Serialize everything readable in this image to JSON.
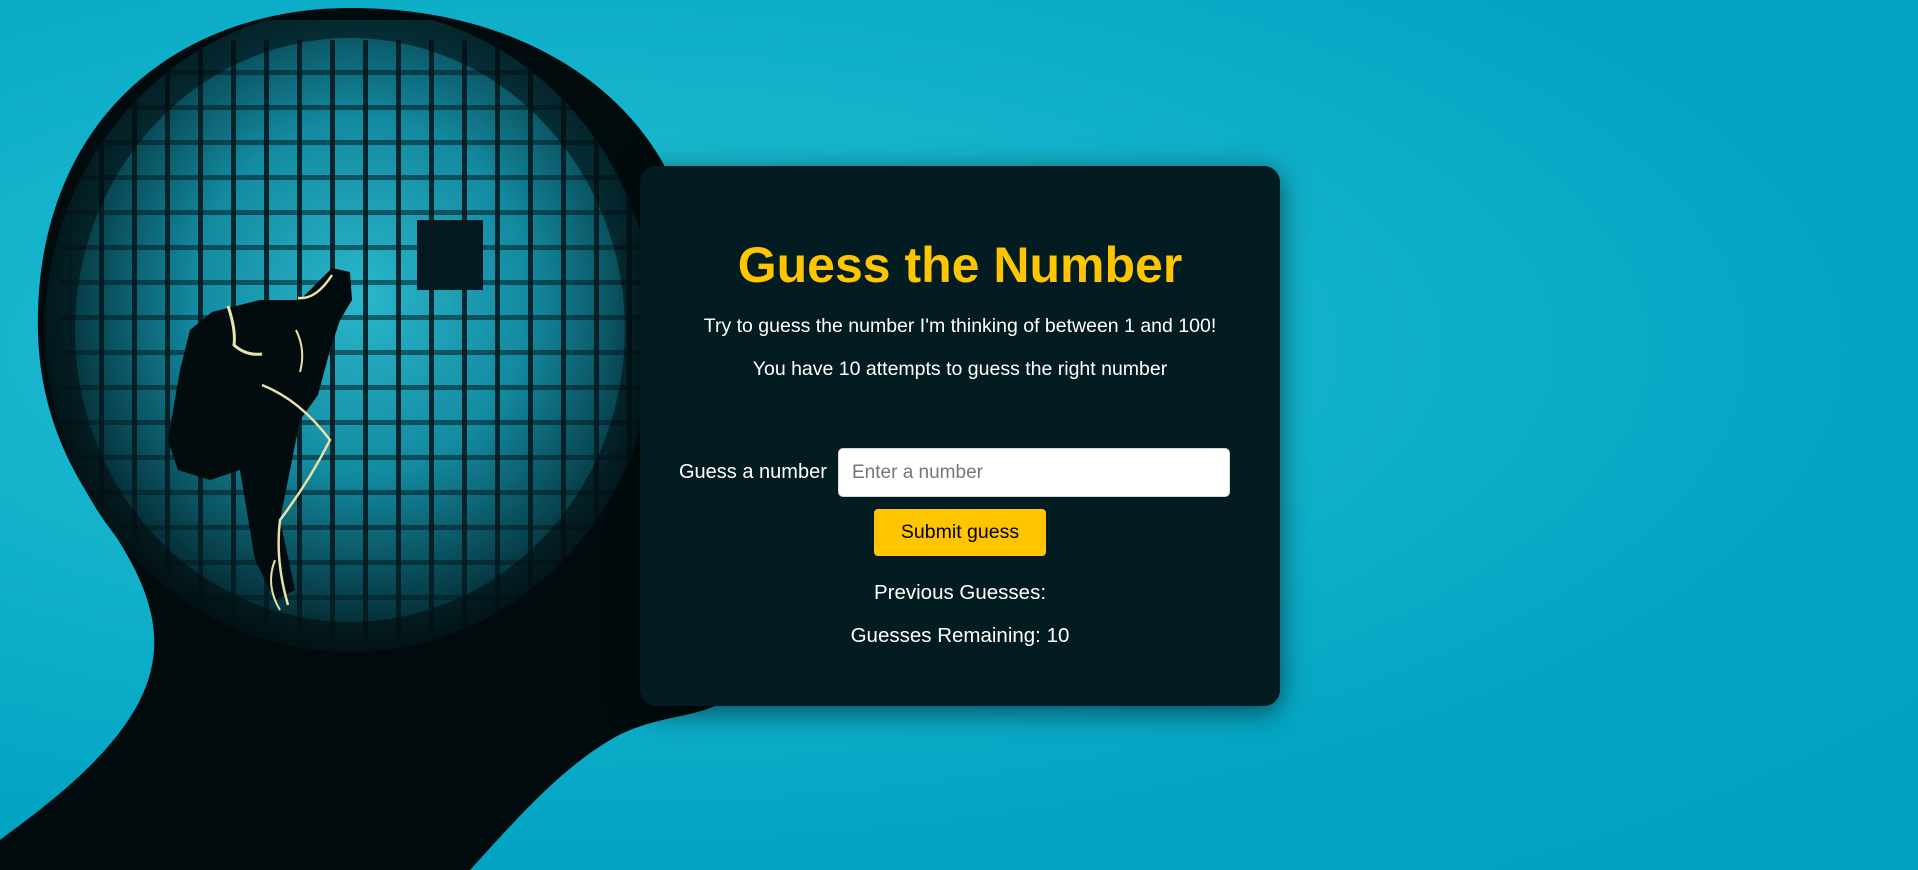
{
  "game": {
    "title": "Guess the Number",
    "intro_line": "Try to guess the number I'm thinking of between 1 and 100!",
    "attempts_line": "You have 10 attempts to guess the right number"
  },
  "form": {
    "label": "Guess a number",
    "input_value": "",
    "input_placeholder": "Enter a number",
    "submit_label": "Submit guess"
  },
  "status": {
    "previous_guesses_label": "Previous Guesses:",
    "guesses_remaining_label": "Guesses Remaining:",
    "guesses_remaining_value": "10",
    "guesses_remaining_text": "Guesses Remaining: 10"
  },
  "colors": {
    "background": "#00a1c0",
    "card": "#021c21",
    "accent": "#ffc600",
    "text": "#ffffff"
  },
  "background_art": {
    "icon": "head-silhouette-prison-thinker-illustration"
  }
}
